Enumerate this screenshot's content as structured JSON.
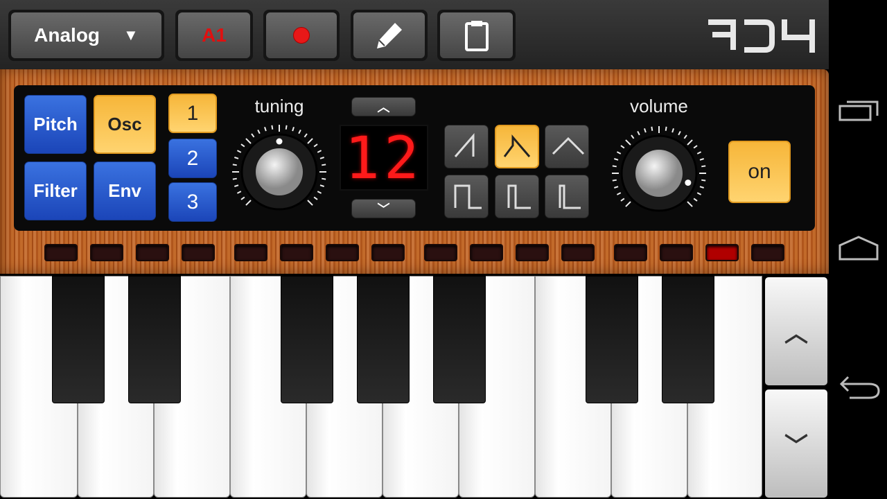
{
  "toolbar": {
    "preset_label": "Analog",
    "pattern_label": "A1",
    "record": "record-icon",
    "edit": "pencil-icon",
    "clipboard": "clipboard-icon",
    "logo": "RD4"
  },
  "sections": {
    "pitch": "Pitch",
    "osc": "Osc",
    "filter": "Filter",
    "env": "Env",
    "selected": "Osc"
  },
  "oscillators": {
    "items": [
      "1",
      "2",
      "3"
    ],
    "selected": "1"
  },
  "tuning": {
    "label": "tuning",
    "knob_value": 0.5
  },
  "display": {
    "value": "12"
  },
  "waveforms": {
    "items": [
      "saw",
      "saw-decay",
      "triangle",
      "pulse-wide",
      "pulse-medium",
      "pulse-narrow"
    ],
    "selected": "saw-decay"
  },
  "volume": {
    "label": "volume",
    "knob_value": 0.9
  },
  "power": {
    "label": "on",
    "active": true
  },
  "steps": {
    "count": 16,
    "active_index": 14
  },
  "colors": {
    "accent_yellow": "#f6b63a",
    "blue": "#2a5ad0",
    "led_red": "#b00000",
    "display_red": "#ff1a1a"
  },
  "nav": {
    "recents": "recent-apps-icon",
    "home": "home-icon",
    "back": "back-icon"
  }
}
